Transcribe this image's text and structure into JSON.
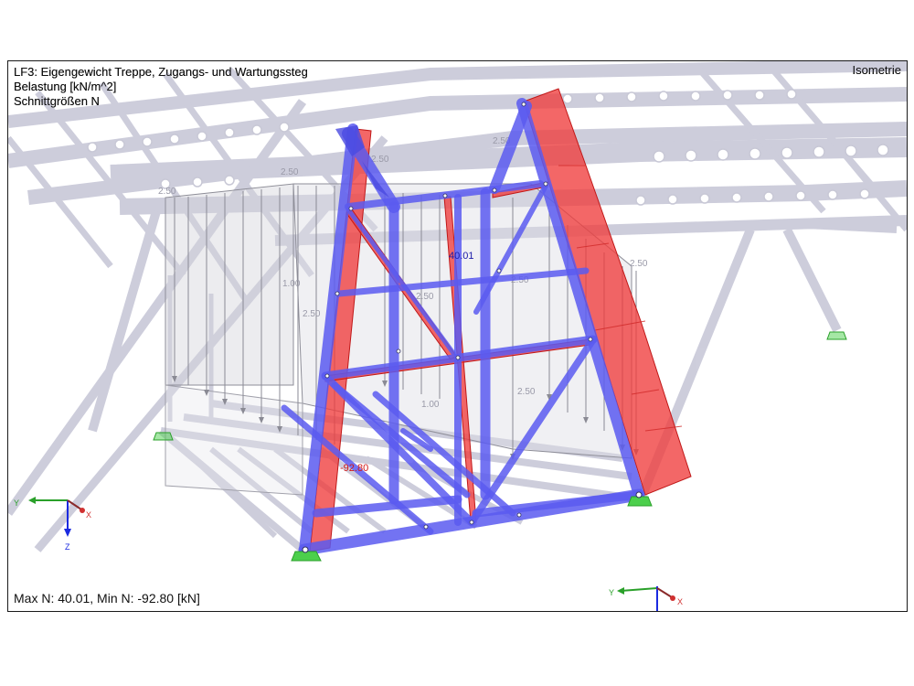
{
  "header": {
    "line1": "LF3: Eigengewicht Treppe, Zugangs- und Wartungssteg",
    "line2": "Belastung [kN/m^2]",
    "line3": "Schnittgrößen N"
  },
  "view_mode": "Isometrie",
  "footer": "Max N: 40.01, Min N: -92.80 [kN]",
  "load_labels": [
    "2.50",
    "2.50",
    "2.50",
    "2.50",
    "2.50",
    "2.50",
    "1.00",
    "2.50",
    "2.50",
    "1.00",
    "2.50"
  ],
  "result_labels": {
    "max": "40.01",
    "min": "-92.80"
  },
  "axes": {
    "y": "Y",
    "x": "X",
    "z": "Z"
  },
  "colors": {
    "member": "#5a5af0",
    "negative_diagram": "#f03c3c",
    "background_structure": "#c8c8d8",
    "support": "#4ccf4c"
  }
}
